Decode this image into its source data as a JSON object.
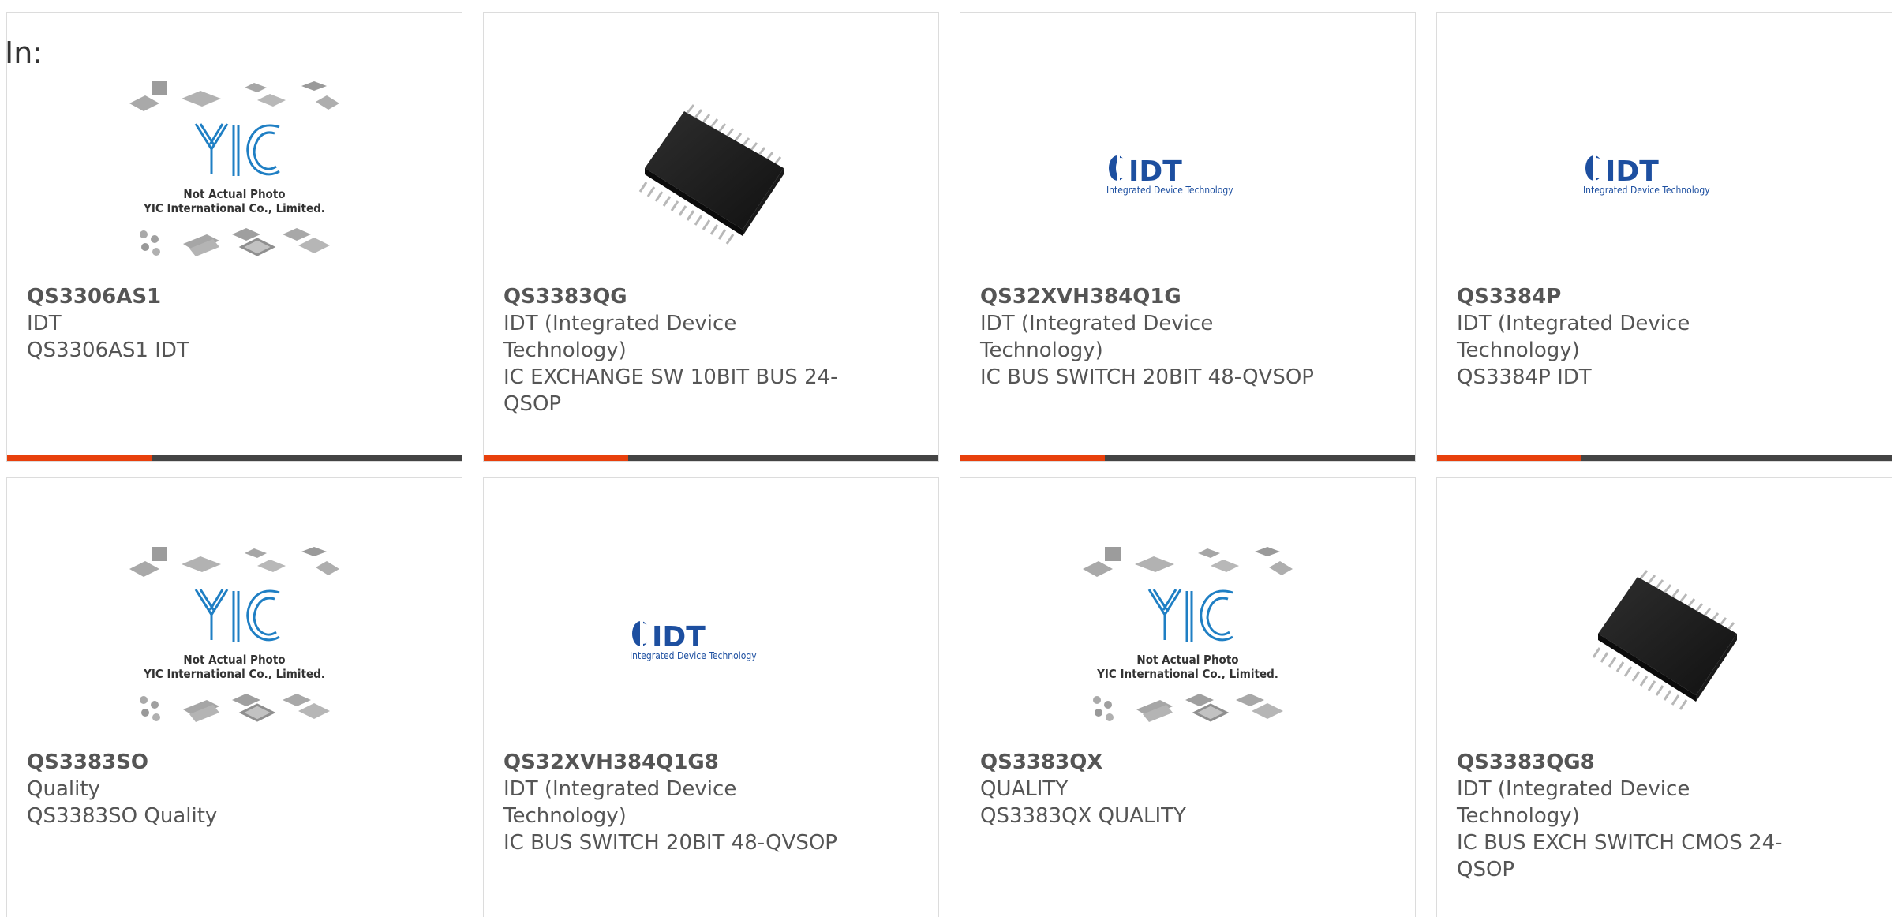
{
  "heading": "In:",
  "products": [
    {
      "part_number": "QS3306AS1",
      "manufacturer": "IDT",
      "description": "QS3306AS1 IDT",
      "image": "yic-placeholder",
      "placeholder_line1": "Not Actual Photo",
      "placeholder_line2": "YIC International Co., Limited.",
      "underline": true
    },
    {
      "part_number": "QS3383QG",
      "manufacturer": "IDT (Integrated Device Technology)",
      "description": "IC EXCHANGE SW 10BIT BUS 24-QSOP",
      "image": "chip-photo",
      "underline": true
    },
    {
      "part_number": "QS32XVH384Q1G",
      "manufacturer": "IDT (Integrated Device Technology)",
      "description": "IC BUS SWITCH 20BIT 48-QVSOP",
      "image": "idt-logo",
      "logo_text": "IDT",
      "logo_tagline": "Integrated Device Technology",
      "underline": true
    },
    {
      "part_number": "QS3384P",
      "manufacturer": "IDT (Integrated Device Technology)",
      "description": "QS3384P IDT",
      "image": "idt-logo",
      "logo_text": "IDT",
      "logo_tagline": "Integrated Device Technology",
      "underline": true
    },
    {
      "part_number": "QS3383SO",
      "manufacturer": "Quality",
      "description": "QS3383SO Quality",
      "image": "yic-placeholder",
      "placeholder_line1": "Not Actual Photo",
      "placeholder_line2": "YIC International Co., Limited."
    },
    {
      "part_number": "QS32XVH384Q1G8",
      "manufacturer": "IDT (Integrated Device Technology)",
      "description": "IC BUS SWITCH 20BIT 48-QVSOP",
      "image": "idt-logo",
      "logo_text": "IDT",
      "logo_tagline": "Integrated Device Technology"
    },
    {
      "part_number": "QS3383QX",
      "manufacturer": "QUALITY",
      "description": "QS3383QX QUALITY",
      "image": "yic-placeholder",
      "placeholder_line1": "Not Actual Photo",
      "placeholder_line2": "YIC International Co., Limited."
    },
    {
      "part_number": "QS3383QG8",
      "manufacturer": "IDT (Integrated Device Technology)",
      "description": "IC BUS EXCH SWITCH CMOS 24-QSOP",
      "image": "chip-photo"
    }
  ],
  "colors": {
    "accent": "#e8400c",
    "underline_dark": "#444444",
    "idt_blue": "#1d4fa0",
    "yic_blue": "#1f7fc4",
    "text": "#555555"
  }
}
